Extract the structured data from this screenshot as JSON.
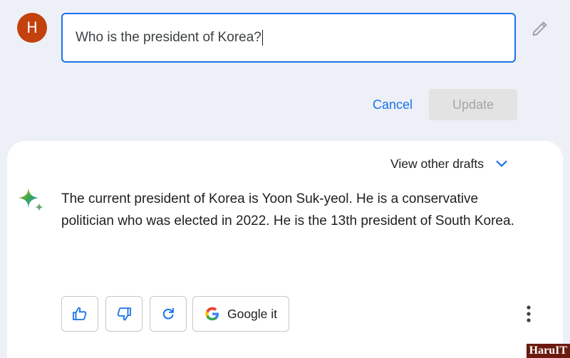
{
  "user": {
    "avatar_initial": "H"
  },
  "prompt": {
    "value": "Who is the president of Korea?"
  },
  "edit_actions": {
    "cancel_label": "Cancel",
    "update_label": "Update"
  },
  "response": {
    "drafts_label": "View other drafts",
    "text": "The current president of Korea is Yoon Suk-yeol. He is a conservative politician who was elected in 2022. He is the 13th president of South Korea."
  },
  "actions": {
    "google_label": "Google it",
    "icons": [
      "thumbs-up-icon",
      "thumbs-down-icon",
      "regenerate-icon",
      "google-icon",
      "more-vert-icon"
    ]
  },
  "watermark": {
    "text": "HaruIT"
  },
  "colors": {
    "accent": "#1a73e8",
    "avatar": "#c2410c",
    "background": "#eef0f7"
  }
}
